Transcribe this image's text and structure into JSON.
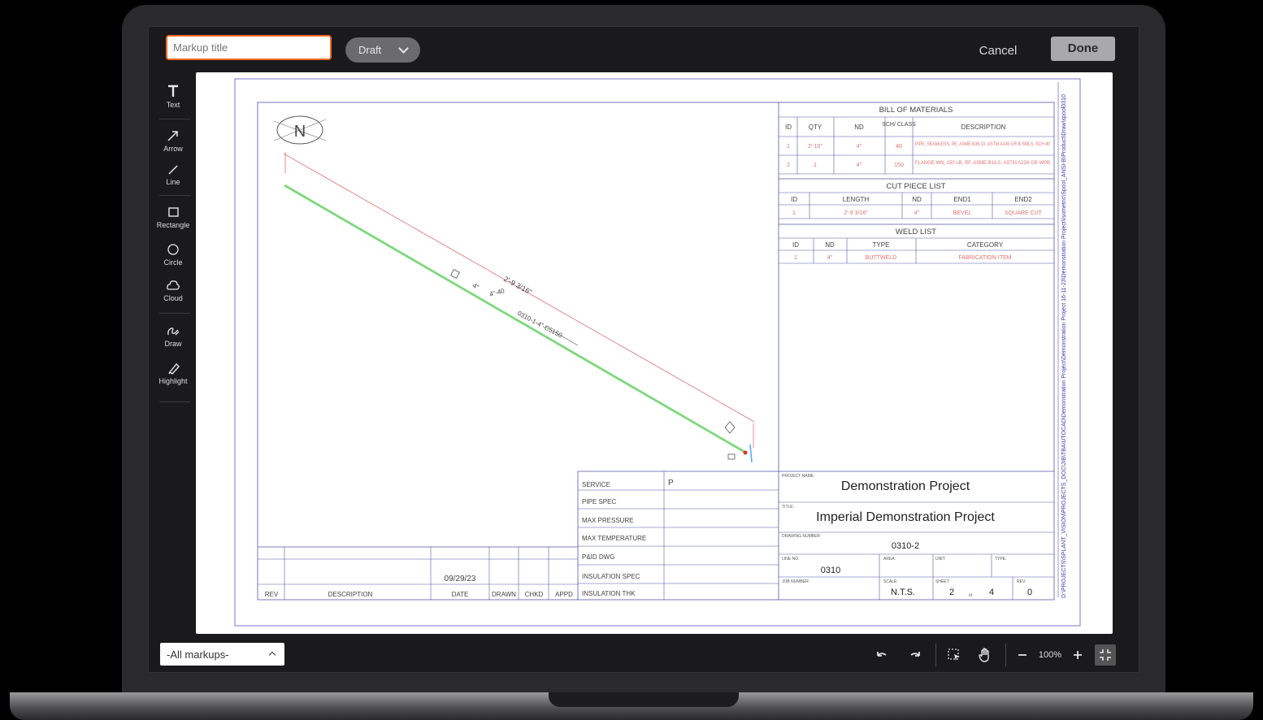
{
  "header": {
    "title_placeholder": "Markup title",
    "status_value": "Draft",
    "cancel_label": "Cancel",
    "done_label": "Done"
  },
  "tools": [
    {
      "label": "Text",
      "icon": "text-icon"
    },
    {
      "label": "Arrow",
      "icon": "arrow-icon"
    },
    {
      "label": "Line",
      "icon": "line-icon"
    },
    {
      "label": "Rectangle",
      "icon": "rectangle-icon"
    },
    {
      "label": "Circle",
      "icon": "circle-icon"
    },
    {
      "label": "Cloud",
      "icon": "cloud-icon"
    },
    {
      "label": "Draw",
      "icon": "draw-icon"
    },
    {
      "label": "Highlight",
      "icon": "highlight-icon"
    }
  ],
  "footer": {
    "filter_value": "-All markups-",
    "zoom": "100%",
    "icons": [
      "undo-icon",
      "redo-icon",
      "select-icon",
      "pan-hand-icon",
      "zoom-out-icon",
      "zoom-in-icon",
      "fit-screen-icon"
    ]
  },
  "drawing": {
    "bom": {
      "title": "BILL  OF  MATERIALS",
      "headers": [
        "ID",
        "QTY",
        "ND",
        "SCH/ CLASS",
        "DESCRIPTION"
      ],
      "rows": [
        [
          "1",
          "2'-10\"",
          "4\"",
          "40",
          "PIPE, SEAMLESS, PE, ASME B36.10, ASTM A106 GR B SMLS, SCH 40"
        ],
        [
          "2",
          "1",
          "4\"",
          "150",
          "FLANGE WN, 150 LB, RF, ASME B16.5, ASTM A234 GR WPB"
        ]
      ]
    },
    "cut_list": {
      "title": "CUT  PIECE  LIST",
      "headers": [
        "ID",
        "LENGTH",
        "ND",
        "END1",
        "END2"
      ],
      "rows": [
        [
          "1",
          "2'-9 3/16\"",
          "4\"",
          "BEVEL",
          "SQUARE CUT"
        ]
      ]
    },
    "weld_list": {
      "title": "WELD  LIST",
      "headers": [
        "ID",
        "ND",
        "TYPE",
        "CATEGORY"
      ],
      "rows": [
        [
          "1",
          "4\"",
          "BUTTWELD",
          "FABRICATION-ITEM"
        ]
      ]
    },
    "service_table": [
      {
        "label": "SERVICE",
        "value": "P"
      },
      {
        "label": "PIPE  SPEC",
        "value": ""
      },
      {
        "label": "MAX  PRESSURE",
        "value": ""
      },
      {
        "label": "MAX  TEMPERATURE",
        "value": ""
      },
      {
        "label": "P&ID  DWG",
        "value": ""
      },
      {
        "label": "INSULATION  SPEC",
        "value": ""
      },
      {
        "label": "INSULATION  THK",
        "value": ""
      }
    ],
    "revision": {
      "date_value": "09/29/23",
      "headers": [
        "REV",
        "DESCRIPTION",
        "DATE",
        "DRAWN",
        "CHKD",
        "APPD"
      ]
    },
    "title_block": {
      "project_name_label": "PROJECT NAME",
      "project_name": "Demonstration Project",
      "title_label": "TITLE:",
      "title": "Imperial Demonstration Project",
      "drawing_number_label": "DRAWING NUMBER",
      "drawing_number": "0310-2",
      "line_no_label": "LINE NO:",
      "line_no": "0310",
      "area_label": "AREA:",
      "unit_label": "UNIT:",
      "type_label": "TYPE:",
      "job_number_label": "JOB NUMBER:",
      "scale_label": "SCALE:",
      "scale": "N.T.S.",
      "sheet_label": "SHEET:",
      "sheet": "2",
      "sheet_of": "of",
      "sheet_total": "4",
      "rev_label": "REV:",
      "rev": "0"
    },
    "side_path": "D:\\PROJECTS\\SPLANT_VISION\\PROJECTS_DOC\\JIB\\TBA\\UTOCAD\\Demonstration Project\\Demonstration Project 16-11-23\\Demonstration Project\\Isometric\\Spool_ANSI-B\\Product\\Draw\\spool0310",
    "north_label": "N",
    "iso_annotations": [
      "2'-9 3/16\"",
      "4\"",
      "4\"-40",
      "0310-1-4\"-C5150"
    ]
  }
}
